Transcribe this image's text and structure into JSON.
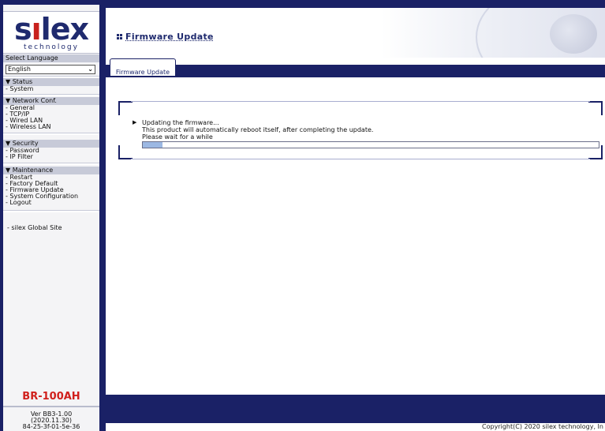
{
  "sidebar": {
    "logo": {
      "main_pre": "s",
      "main_red": "ı",
      "main_post": "lex",
      "sub": "technology"
    },
    "language": {
      "heading": "Select Language",
      "selected": "English"
    },
    "status": {
      "heading": "▼ Status",
      "items": [
        "- System"
      ]
    },
    "network": {
      "heading": "▼ Network Conf.",
      "items": [
        "- General",
        "- TCP/IP",
        "- Wired LAN",
        "- Wireless LAN"
      ]
    },
    "security": {
      "heading": "▼ Security",
      "items": [
        "- Password",
        "- IP Filter"
      ]
    },
    "maintenance": {
      "heading": "▼ Maintenance",
      "items": [
        "- Restart",
        "- Factory Default",
        "- Firmware Update",
        "- System Configuration",
        "- Logout"
      ]
    },
    "global_link": "- silex Global Site",
    "model": "BR-100AH",
    "version": [
      "Ver BB3-1.00",
      "(2020.11.30)",
      "84-25-3f-01-5e-36"
    ]
  },
  "header": {
    "title": "Firmware Update"
  },
  "tabs": [
    {
      "label": "Firmware Update",
      "active": true
    }
  ],
  "content": {
    "line1": "Updating the firmware...",
    "line2": "This product will automatically reboot itself, after completing the update.",
    "line3": "Please wait for a while",
    "progress_fraction": 0.043
  },
  "footer": {
    "copyright": "Copyright(C) 2020 silex technology, In"
  },
  "colors": {
    "navy": "#1a2166",
    "accent_red": "#d0201c",
    "progress": "#9cb8e3"
  }
}
